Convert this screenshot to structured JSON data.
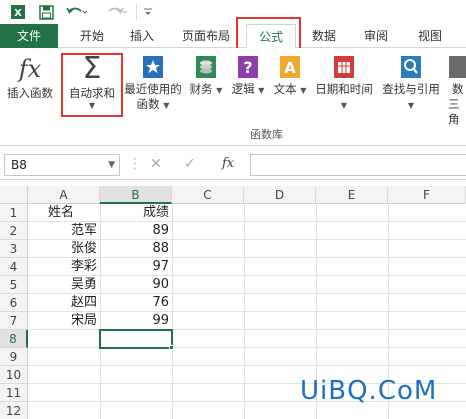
{
  "qat": {
    "save": "save-icon",
    "undo": "undo-icon",
    "redo": "redo-icon",
    "customize": "customize-qat-icon"
  },
  "tabs": [
    {
      "label": "文件"
    },
    {
      "label": "开始"
    },
    {
      "label": "插入"
    },
    {
      "label": "页面布局"
    },
    {
      "label": "公式"
    },
    {
      "label": "数据"
    },
    {
      "label": "审阅"
    },
    {
      "label": "视图"
    }
  ],
  "ribbon": {
    "insert_function": "插入函数",
    "autosum": "自动求和",
    "recent_line1": "最近使用的",
    "recent_line2": "函数",
    "financial": "财务",
    "logical": "逻辑",
    "text": "文本",
    "datetime": "日期和时间",
    "lookup": "查找与引用",
    "math_line1": "数",
    "math_line2": "三角",
    "group_label": "函数库",
    "fx_glyph": "fx",
    "sigma_glyph": "Σ"
  },
  "formula_bar": {
    "name_box": "B8",
    "fx": "fx",
    "cancel": "✕",
    "enter": "✓"
  },
  "columns": [
    "A",
    "B",
    "C",
    "D",
    "E",
    "F"
  ],
  "rows": [
    "1",
    "2",
    "3",
    "4",
    "5",
    "6",
    "7",
    "8",
    "9",
    "10",
    "11",
    "12"
  ],
  "table": {
    "header": {
      "a": "姓名",
      "b": "成绩"
    },
    "rows": [
      {
        "a": "范军",
        "b": "89"
      },
      {
        "a": "张俊",
        "b": "88"
      },
      {
        "a": "李彩",
        "b": "97"
      },
      {
        "a": "吴勇",
        "b": "90"
      },
      {
        "a": "赵四",
        "b": "76"
      },
      {
        "a": "宋局",
        "b": "99"
      }
    ]
  },
  "watermark": "UiBQ.CoM",
  "colors": {
    "excel_green": "#217346",
    "highlight_red": "#e53232"
  }
}
